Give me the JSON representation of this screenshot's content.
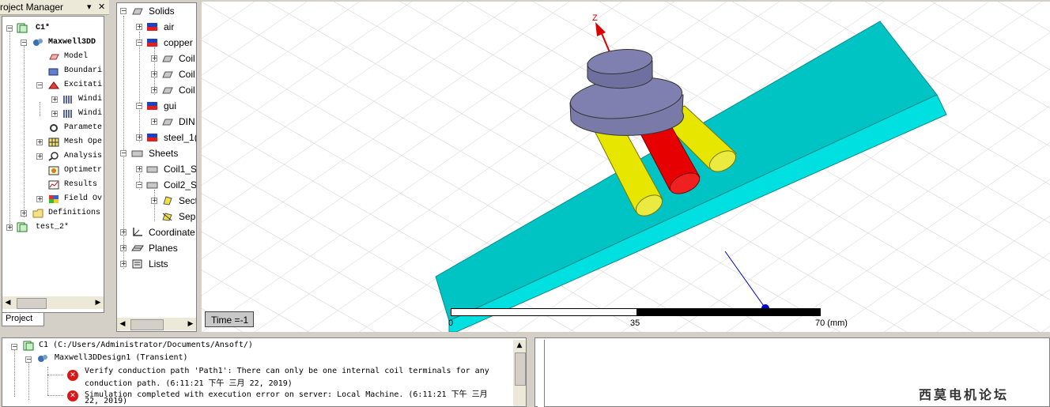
{
  "project_manager": {
    "title": "roject Manager",
    "pin": "▾",
    "close": "✕",
    "tab": "Project",
    "items": [
      {
        "label": "C1*"
      },
      {
        "label": "Maxwell3DD"
      },
      {
        "label": "Model"
      },
      {
        "label": "Boundari"
      },
      {
        "label": "Excitati"
      },
      {
        "label": "Windi"
      },
      {
        "label": "Windi"
      },
      {
        "label": "Paramete"
      },
      {
        "label": "Mesh Ope"
      },
      {
        "label": "Analysis"
      },
      {
        "label": "Optimetr"
      },
      {
        "label": "Results"
      },
      {
        "label": "Field Ov"
      },
      {
        "label": "Definitions"
      },
      {
        "label": "test_2*"
      }
    ]
  },
  "model_tree": {
    "items": [
      {
        "label": "Solids"
      },
      {
        "label": "air"
      },
      {
        "label": "copper"
      },
      {
        "label": "Coil"
      },
      {
        "label": "Coil"
      },
      {
        "label": "Coil"
      },
      {
        "label": "gui"
      },
      {
        "label": "DIN"
      },
      {
        "label": "steel_1("
      },
      {
        "label": "Sheets"
      },
      {
        "label": "Coil1_S"
      },
      {
        "label": "Coil2_S"
      },
      {
        "label": "Sect"
      },
      {
        "label": "Sep"
      },
      {
        "label": "Coordinate"
      },
      {
        "label": "Planes"
      },
      {
        "label": "Lists"
      }
    ]
  },
  "viewport": {
    "time_label": "Time =-1",
    "axis_label": "Z",
    "scale": {
      "ticks": [
        "0",
        "35",
        "70 (mm)"
      ]
    },
    "colors": {
      "block": "#00d2d2",
      "cap": "#7a7aa8",
      "yellow": "#e6e600",
      "red": "#e60000"
    }
  },
  "messages": {
    "project_line": "C1 (C:/Users/Administrator/Documents/Ansoft/)",
    "design_line": "Maxwell3DDesign1 (Transient)",
    "error1_a": "Verify conduction path 'Path1': There can only be one internal coil terminals for any",
    "error1_b": "conduction path. (6:11:21 下午  三月 22, 2019)",
    "error2_a": "Simulation completed with execution error on server: Local Machine. (6:11:21 下午  三月",
    "error2_b": "22, 2019)"
  },
  "watermark": "西莫电机论坛"
}
